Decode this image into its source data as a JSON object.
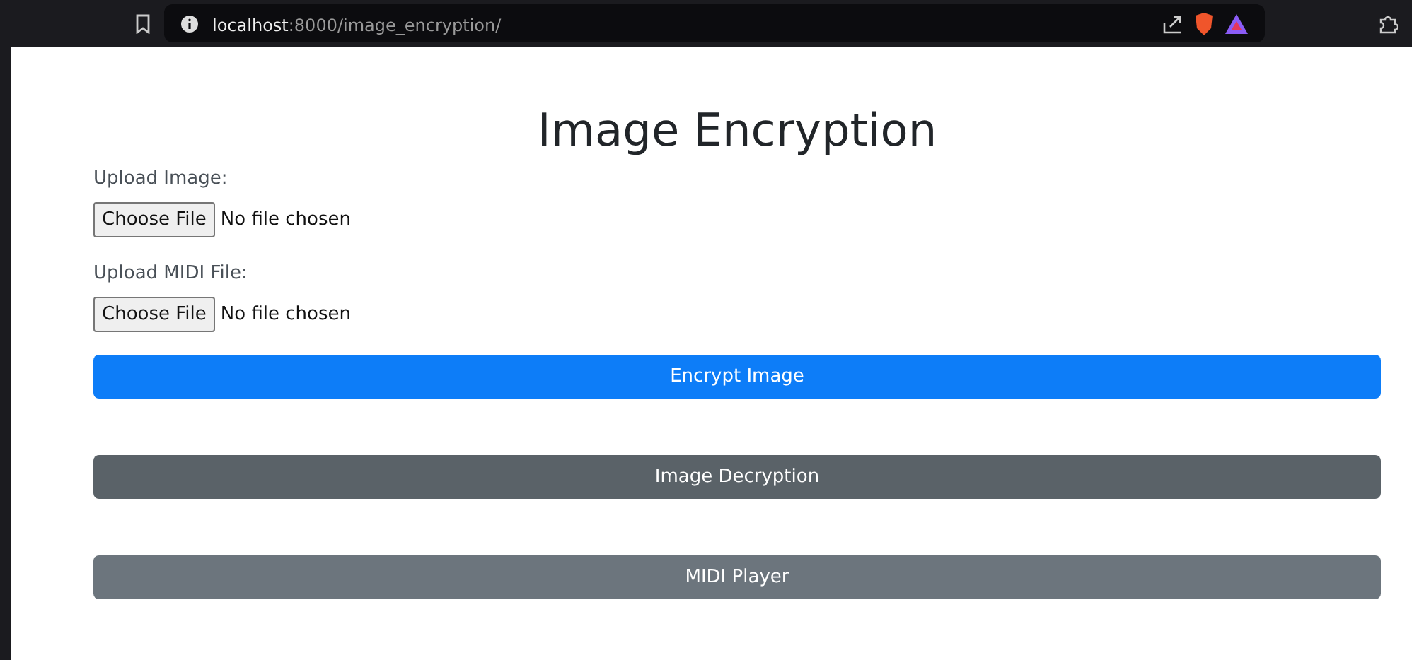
{
  "browser": {
    "address_host": "localhost",
    "address_path": ":8000/image_encryption/"
  },
  "page": {
    "title": "Image Encryption",
    "fields": [
      {
        "label": "Upload Image:",
        "button": "Choose File",
        "status": "No file chosen"
      },
      {
        "label": "Upload MIDI File:",
        "button": "Choose File",
        "status": "No file chosen"
      }
    ],
    "buttons": [
      {
        "label": "Encrypt Image",
        "kind": "primary"
      },
      {
        "label": "Image Decryption",
        "kind": "dark"
      },
      {
        "label": "MIDI Player",
        "kind": "secondary"
      }
    ]
  }
}
